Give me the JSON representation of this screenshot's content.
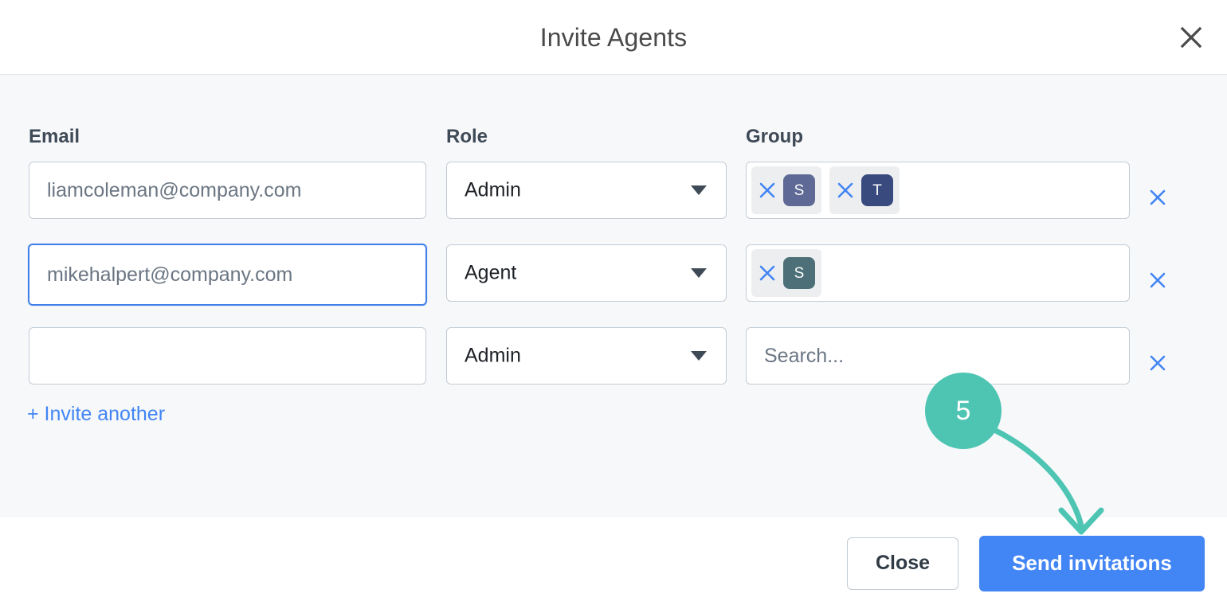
{
  "dialog": {
    "title": "Invite Agents",
    "close_icon": "close-icon"
  },
  "columns": {
    "email": "Email",
    "role": "Role",
    "group": "Group"
  },
  "rows": [
    {
      "email_value": "",
      "email_placeholder": "liamcoleman@company.com",
      "email_focused": false,
      "role": "Admin",
      "group_search_placeholder": "",
      "chips": [
        {
          "letter": "S",
          "color": "#5e6a95",
          "remove_icon": "close-icon"
        },
        {
          "letter": "T",
          "color": "#394a7e",
          "remove_icon": "close-icon"
        }
      ],
      "remove_row_icon": "close-icon"
    },
    {
      "email_value": "",
      "email_placeholder": "mikehalpert@company.com",
      "email_focused": true,
      "role": "Agent",
      "group_search_placeholder": "",
      "chips": [
        {
          "letter": "S",
          "color": "#4d7078",
          "remove_icon": "close-icon"
        }
      ],
      "remove_row_icon": "close-icon"
    },
    {
      "email_value": "",
      "email_placeholder": "",
      "email_focused": false,
      "role": "Admin",
      "group_search_placeholder": "Search...",
      "chips": [],
      "remove_row_icon": "close-icon"
    }
  ],
  "invite_another": "+ Invite another",
  "footer": {
    "close_label": "Close",
    "send_label": "Send invitations"
  },
  "annotation": {
    "step_number": "5",
    "color": "#4ec5b3"
  },
  "theme": {
    "accent_blue": "#4285f4",
    "body_background": "#f7f8fa",
    "border": "#c3ccd5",
    "focus_blue": "#4080e8",
    "chip_background": "#eceef0"
  }
}
